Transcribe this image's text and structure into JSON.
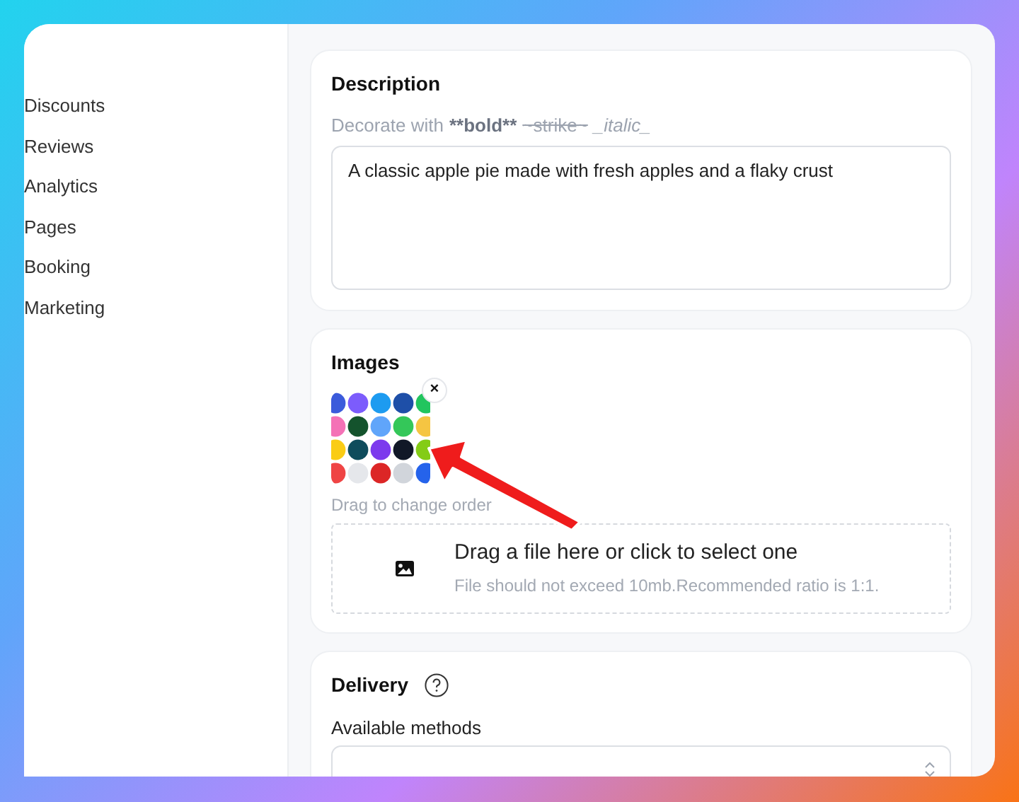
{
  "sidebar": {
    "items": [
      {
        "label": "Discounts"
      },
      {
        "label": "Reviews"
      },
      {
        "label": "Analytics"
      },
      {
        "label": "Pages"
      },
      {
        "label": "Booking"
      },
      {
        "label": "Marketing"
      }
    ]
  },
  "description": {
    "title": "Description",
    "hint": [
      {
        "kind": "plain",
        "text": "Decorate with"
      },
      {
        "kind": "bold",
        "text": "**bold**"
      },
      {
        "kind": "strike",
        "text": "~strike~"
      },
      {
        "kind": "italic",
        "text": "_italic_"
      }
    ],
    "value": "A classic apple pie made with fresh apples and a flaky crust"
  },
  "images": {
    "title": "Images",
    "remove": "×",
    "drag_hint": "Drag to change order",
    "dropzone": {
      "title": "Drag a file here or click to select one",
      "subtitle": "File should not exceed 10mb.Recommended ratio is 1:1."
    }
  },
  "delivery": {
    "title": "Delivery",
    "methods_label": "Available methods"
  }
}
